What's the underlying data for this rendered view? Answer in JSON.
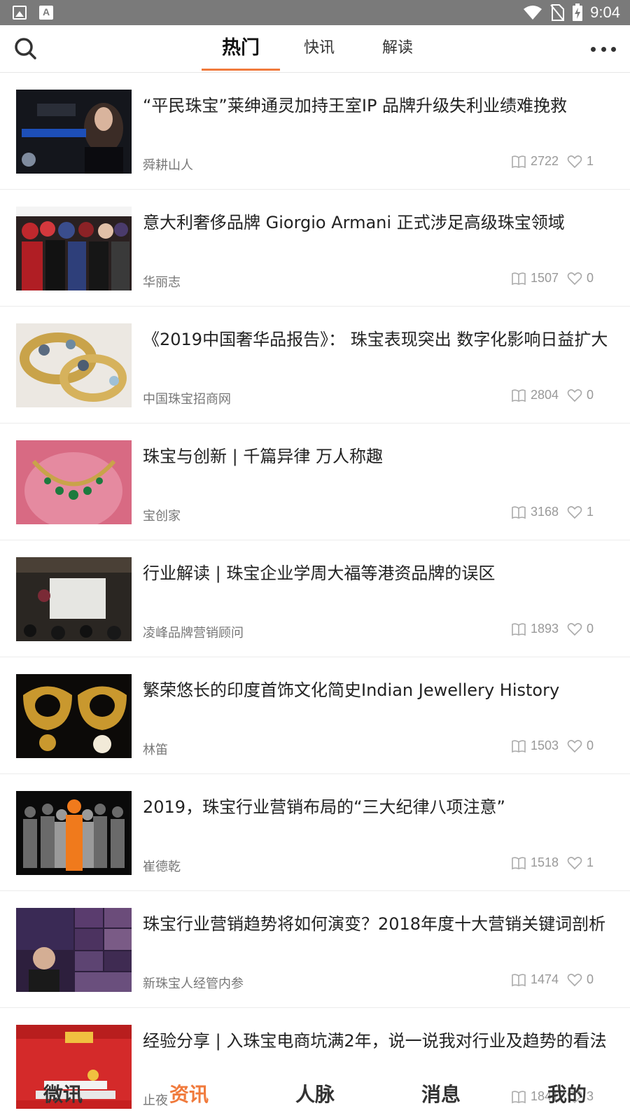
{
  "status_bar": {
    "time": "9:04",
    "left_icons": [
      "image-icon",
      "font-icon"
    ],
    "right_icons": [
      "wifi-icon",
      "no-sim-icon",
      "battery-charging-icon"
    ]
  },
  "header": {
    "search_icon": "search-icon",
    "more_icon": "more-dots-icon",
    "tabs": [
      {
        "label": "热门",
        "active": true
      },
      {
        "label": "快讯",
        "active": false
      },
      {
        "label": "解读",
        "active": false
      }
    ]
  },
  "articles": [
    {
      "title": "“平民珠宝”莱绅通灵加持王室IP 品牌升级失利业绩难挽救",
      "source": "舜耕山人",
      "views": "2722",
      "likes": "1",
      "thumb_desc": "珠宝广告"
    },
    {
      "title": "意大利奢侈品牌 Giorgio Armani 正式涉足高级珠宝领域",
      "source": "华丽志",
      "views": "1507",
      "likes": "0",
      "thumb_desc": "品牌合影"
    },
    {
      "title": "《2019中国奢华品报告》： 珠宝表现突出 数字化影响日益扩大",
      "source": "中国珠宝招商网",
      "views": "2804",
      "likes": "0",
      "thumb_desc": "戒指"
    },
    {
      "title": "珠宝与创新 | 千篇异律 万人称趣",
      "source": "宝创家",
      "views": "3168",
      "likes": "1",
      "thumb_desc": "项链"
    },
    {
      "title": "行业解读 | 珠宝企业学周大福等港资品牌的误区",
      "source": "凌峰品牌营销顾问",
      "views": "1893",
      "likes": "0",
      "thumb_desc": "会场"
    },
    {
      "title": "繁荣悠长的印度首饰文化简史Indian Jewellery History",
      "source": "林笛",
      "views": "1503",
      "likes": "0",
      "thumb_desc": "耳环"
    },
    {
      "title": "2019，珠宝行业营销布局的“三大纪律八项注意”",
      "source": "崔德乾",
      "views": "1518",
      "likes": "1",
      "thumb_desc": "人群剪影"
    },
    {
      "title": "珠宝行业营销趋势将如何演变？2018年度十大营销关键词剖析",
      "source": "新珠宝人经管内参",
      "views": "1474",
      "likes": "0",
      "thumb_desc": "直播拼图"
    },
    {
      "title": "经验分享 | 入珠宝电商坑满2年，说一说我对行业及趋势的看法",
      "source": "止夜",
      "views": "1841",
      "likes": "3",
      "thumb_desc": "促销海报"
    }
  ],
  "bottom_nav": [
    {
      "label": "微讯",
      "active": false
    },
    {
      "label": "资讯",
      "active": true
    },
    {
      "label": "人脉",
      "active": false
    },
    {
      "label": "消息",
      "active": false
    },
    {
      "label": "我的",
      "active": false
    }
  ],
  "colors": {
    "accent": "#f07a3c",
    "status_bar": "#7a7a7a",
    "text": "#222222",
    "meta": "#999999"
  }
}
